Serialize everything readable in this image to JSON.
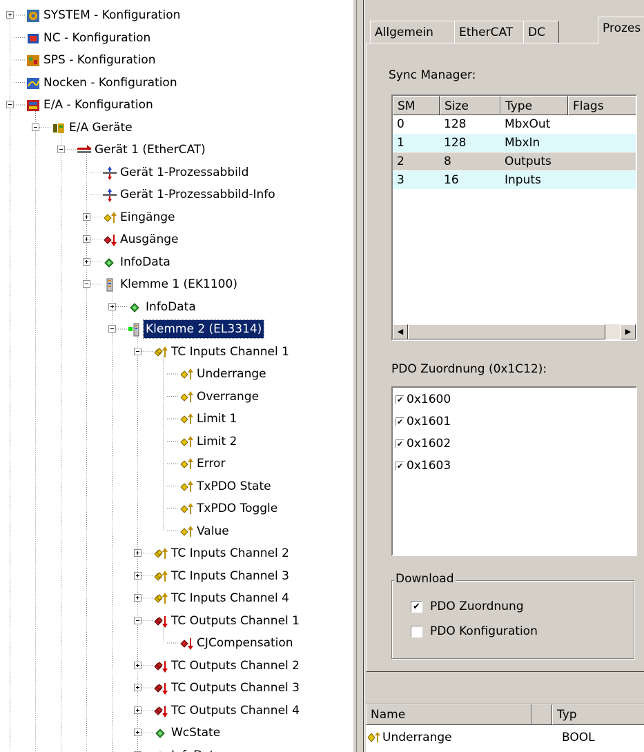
{
  "tree": {
    "items": [
      {
        "label": "SYSTEM - Konfiguration",
        "icon": "system-config-icon"
      },
      {
        "label": "NC - Konfiguration",
        "icon": "nc-config-icon"
      },
      {
        "label": "SPS - Konfiguration",
        "icon": "sps-config-icon"
      },
      {
        "label": "Nocken - Konfiguration",
        "icon": "cam-config-icon"
      },
      {
        "label": "E/A - Konfiguration",
        "icon": "io-config-icon"
      },
      {
        "label": "E/A Geräte",
        "icon": "io-devices-icon"
      },
      {
        "label": "Gerät 1 (EtherCAT)",
        "icon": "ethercat-device-icon"
      },
      {
        "label": "Gerät 1-Prozessabbild",
        "icon": "process-image-icon"
      },
      {
        "label": "Gerät 1-Prozessabbild-Info",
        "icon": "process-image-icon"
      },
      {
        "label": "Eingänge",
        "icon": "inputs-icon"
      },
      {
        "label": "Ausgänge",
        "icon": "outputs-icon"
      },
      {
        "label": "InfoData",
        "icon": "infodata-icon"
      },
      {
        "label": "Klemme 1 (EK1100)",
        "icon": "terminal-icon"
      },
      {
        "label": "InfoData",
        "icon": "infodata-icon"
      },
      {
        "label": "Klemme 2 (EL3314)",
        "icon": "terminal-active-icon"
      },
      {
        "label": "TC Inputs Channel 1",
        "icon": "input-channel-icon"
      },
      {
        "label": "Underrange",
        "icon": "input-var-icon"
      },
      {
        "label": "Overrange",
        "icon": "input-var-icon"
      },
      {
        "label": "Limit 1",
        "icon": "input-var-icon"
      },
      {
        "label": "Limit 2",
        "icon": "input-var-icon"
      },
      {
        "label": "Error",
        "icon": "input-var-icon"
      },
      {
        "label": "TxPDO State",
        "icon": "input-var-icon"
      },
      {
        "label": "TxPDO Toggle",
        "icon": "input-var-icon"
      },
      {
        "label": "Value",
        "icon": "input-var-icon"
      },
      {
        "label": "TC Inputs Channel 2",
        "icon": "input-channel-icon"
      },
      {
        "label": "TC Inputs Channel 3",
        "icon": "input-channel-icon"
      },
      {
        "label": "TC Inputs Channel 4",
        "icon": "input-channel-icon"
      },
      {
        "label": "TC Outputs Channel 1",
        "icon": "output-channel-icon"
      },
      {
        "label": "CJCompensation",
        "icon": "output-var-icon"
      },
      {
        "label": "TC Outputs Channel 2",
        "icon": "output-channel-icon"
      },
      {
        "label": "TC Outputs Channel 3",
        "icon": "output-channel-icon"
      },
      {
        "label": "TC Outputs Channel 4",
        "icon": "output-channel-icon"
      },
      {
        "label": "WcState",
        "icon": "infodata-icon"
      },
      {
        "label": "InfoData",
        "icon": "infodata-icon"
      }
    ]
  },
  "tabs": [
    "Allgemein",
    "EtherCAT",
    "DC",
    "Prozes"
  ],
  "sync_manager": {
    "label": "Sync Manager:",
    "columns": [
      "SM",
      "Size",
      "Type",
      "Flags"
    ],
    "rows": [
      [
        "0",
        "128",
        "MbxOut",
        ""
      ],
      [
        "1",
        "128",
        "MbxIn",
        ""
      ],
      [
        "2",
        "8",
        "Outputs",
        ""
      ],
      [
        "3",
        "16",
        "Inputs",
        ""
      ]
    ]
  },
  "pdo": {
    "label": "PDO Zuordnung (0x1C12):",
    "items": [
      "0x1600",
      "0x1601",
      "0x1602",
      "0x1603"
    ]
  },
  "download": {
    "label": "Download",
    "items": [
      {
        "label": "PDO Zuordnung",
        "checked": true
      },
      {
        "label": "PDO Konfiguration",
        "checked": false
      }
    ]
  },
  "varlist": {
    "columns": [
      "Name",
      "Typ"
    ],
    "rows": [
      [
        "Underrange",
        "BOOL"
      ]
    ]
  },
  "colors": {
    "selection": "#0a246a",
    "row_highlight": "#ddf9fc",
    "row_selected_gray": "#d4d0c8",
    "panel": "#d4d0c8"
  }
}
